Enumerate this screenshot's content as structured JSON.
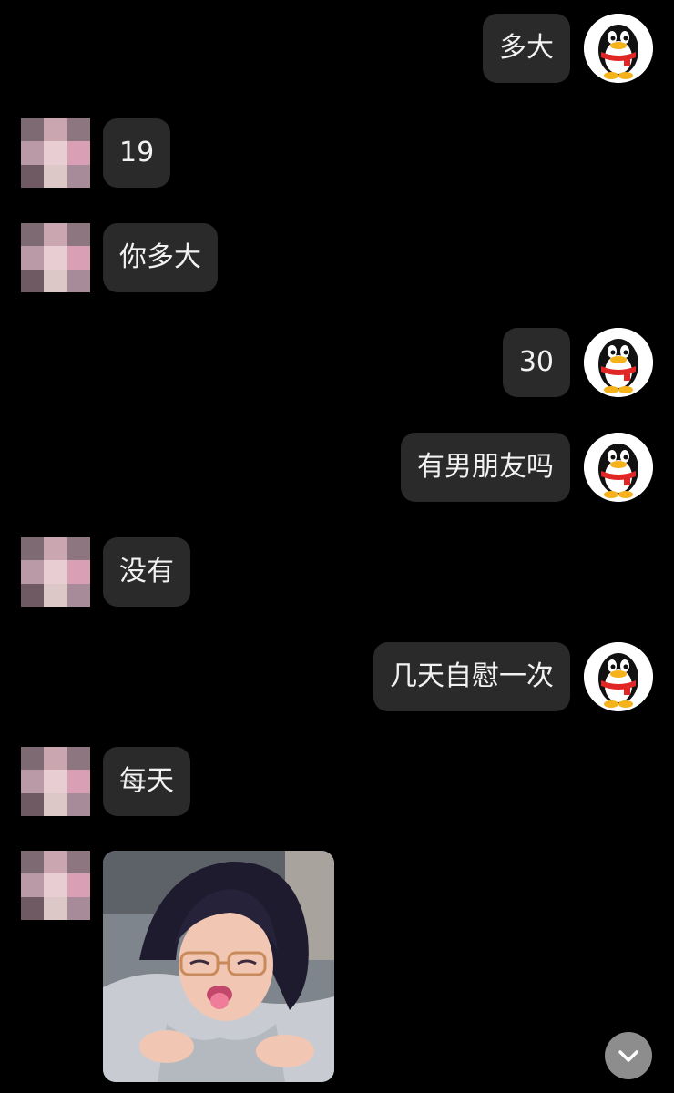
{
  "conversation": {
    "messages": [
      {
        "sender": "me",
        "kind": "text",
        "text": "多大"
      },
      {
        "sender": "contact",
        "kind": "text",
        "text": "19"
      },
      {
        "sender": "contact",
        "kind": "text",
        "text": "你多大"
      },
      {
        "sender": "me",
        "kind": "text",
        "text": "30"
      },
      {
        "sender": "me",
        "kind": "text",
        "text": "有男朋友吗"
      },
      {
        "sender": "contact",
        "kind": "text",
        "text": "没有"
      },
      {
        "sender": "me",
        "kind": "text",
        "text": "几天自慰一次"
      },
      {
        "sender": "contact",
        "kind": "text",
        "text": "每天"
      },
      {
        "sender": "contact",
        "kind": "image",
        "text": ""
      }
    ]
  },
  "avatars": {
    "me": {
      "icon": "penguin-avatar-icon",
      "colors": {
        "body": "#111111",
        "belly": "#ffffff",
        "beak": "#f5b21b",
        "scarf": "#e12626"
      }
    },
    "contact": {
      "icon": "pixelated-avatar",
      "pixel_colors": [
        "#7d6a72",
        "#c9a6b0",
        "#8e7680",
        "#b99aa6",
        "#e8cdd2",
        "#d99fb5",
        "#6f5a64",
        "#dcc8c6",
        "#a78b98"
      ]
    }
  },
  "controls": {
    "scroll_to_bottom_icon": "chevron-down-icon"
  },
  "colors": {
    "background": "#000000",
    "bubble": "#2a2a2a",
    "bubble_text": "#f2f2f2",
    "scroll_button": "#8d8d8d"
  }
}
